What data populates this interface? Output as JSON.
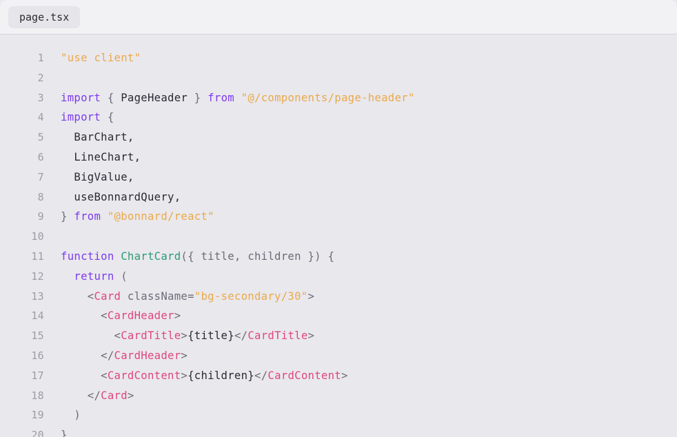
{
  "tab": {
    "label": "page.tsx"
  },
  "lines": [
    {
      "n": "1",
      "tokens": [
        {
          "t": "\"use client\"",
          "c": "str"
        }
      ]
    },
    {
      "n": "2",
      "tokens": []
    },
    {
      "n": "3",
      "tokens": [
        {
          "t": "import",
          "c": "kw"
        },
        {
          "t": " { ",
          "c": "pl"
        },
        {
          "t": "PageHeader",
          "c": "id"
        },
        {
          "t": " } ",
          "c": "pl"
        },
        {
          "t": "from",
          "c": "kw"
        },
        {
          "t": " ",
          "c": "pl"
        },
        {
          "t": "\"@/components/page-header\"",
          "c": "str"
        }
      ]
    },
    {
      "n": "4",
      "tokens": [
        {
          "t": "import",
          "c": "kw"
        },
        {
          "t": " {",
          "c": "pl"
        }
      ]
    },
    {
      "n": "5",
      "tokens": [
        {
          "t": "  BarChart,",
          "c": "id"
        }
      ]
    },
    {
      "n": "6",
      "tokens": [
        {
          "t": "  LineChart,",
          "c": "id"
        }
      ]
    },
    {
      "n": "7",
      "tokens": [
        {
          "t": "  BigValue,",
          "c": "id"
        }
      ]
    },
    {
      "n": "8",
      "tokens": [
        {
          "t": "  useBonnardQuery,",
          "c": "id"
        }
      ]
    },
    {
      "n": "9",
      "tokens": [
        {
          "t": "} ",
          "c": "pl"
        },
        {
          "t": "from",
          "c": "kw"
        },
        {
          "t": " ",
          "c": "pl"
        },
        {
          "t": "\"@bonnard/react\"",
          "c": "str"
        }
      ]
    },
    {
      "n": "10",
      "tokens": []
    },
    {
      "n": "11",
      "tokens": [
        {
          "t": "function",
          "c": "kw"
        },
        {
          "t": " ",
          "c": "pl"
        },
        {
          "t": "ChartCard",
          "c": "fn"
        },
        {
          "t": "({ title, children }) {",
          "c": "pl"
        }
      ]
    },
    {
      "n": "12",
      "tokens": [
        {
          "t": "  ",
          "c": "pl"
        },
        {
          "t": "return",
          "c": "kw"
        },
        {
          "t": " (",
          "c": "pl"
        }
      ]
    },
    {
      "n": "13",
      "tokens": [
        {
          "t": "    <",
          "c": "pl"
        },
        {
          "t": "Card",
          "c": "tag"
        },
        {
          "t": " className=",
          "c": "pl"
        },
        {
          "t": "\"bg-secondary/30\"",
          "c": "str"
        },
        {
          "t": ">",
          "c": "pl"
        }
      ]
    },
    {
      "n": "14",
      "tokens": [
        {
          "t": "      <",
          "c": "pl"
        },
        {
          "t": "CardHeader",
          "c": "tag"
        },
        {
          "t": ">",
          "c": "pl"
        }
      ]
    },
    {
      "n": "15",
      "tokens": [
        {
          "t": "        <",
          "c": "pl"
        },
        {
          "t": "CardTitle",
          "c": "tag"
        },
        {
          "t": ">",
          "c": "pl"
        },
        {
          "t": "{title}",
          "c": "id"
        },
        {
          "t": "</",
          "c": "pl"
        },
        {
          "t": "CardTitle",
          "c": "tag"
        },
        {
          "t": ">",
          "c": "pl"
        }
      ]
    },
    {
      "n": "16",
      "tokens": [
        {
          "t": "      </",
          "c": "pl"
        },
        {
          "t": "CardHeader",
          "c": "tag"
        },
        {
          "t": ">",
          "c": "pl"
        }
      ]
    },
    {
      "n": "17",
      "tokens": [
        {
          "t": "      <",
          "c": "pl"
        },
        {
          "t": "CardContent",
          "c": "tag"
        },
        {
          "t": ">",
          "c": "pl"
        },
        {
          "t": "{children}",
          "c": "id"
        },
        {
          "t": "</",
          "c": "pl"
        },
        {
          "t": "CardContent",
          "c": "tag"
        },
        {
          "t": ">",
          "c": "pl"
        }
      ]
    },
    {
      "n": "18",
      "tokens": [
        {
          "t": "    </",
          "c": "pl"
        },
        {
          "t": "Card",
          "c": "tag"
        },
        {
          "t": ">",
          "c": "pl"
        }
      ]
    },
    {
      "n": "19",
      "tokens": [
        {
          "t": "  )",
          "c": "pl"
        }
      ]
    },
    {
      "n": "20",
      "tokens": [
        {
          "t": "}",
          "c": "pl"
        }
      ]
    }
  ]
}
